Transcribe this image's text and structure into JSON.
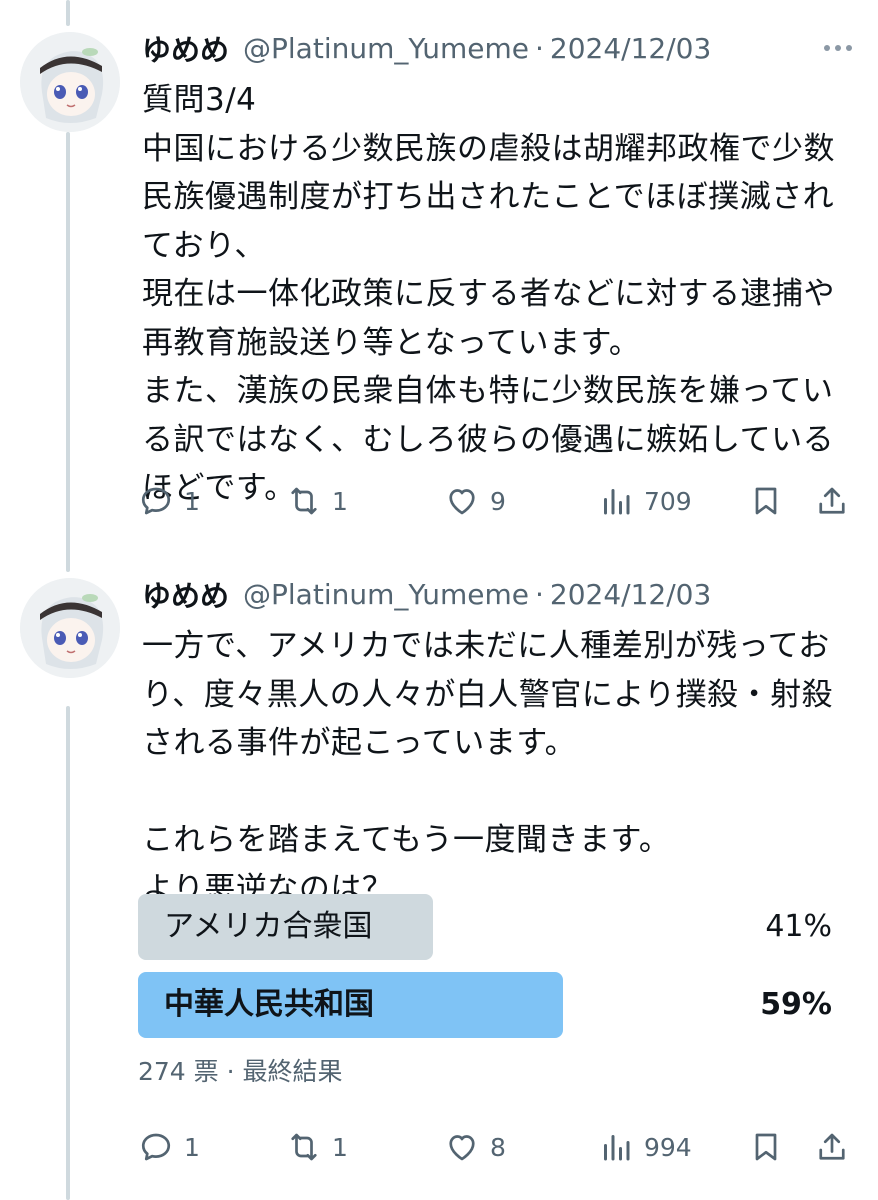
{
  "tweets": [
    {
      "author": {
        "name": "ゆめめ",
        "handle": "@Platinum_Yumeme",
        "separator": "·",
        "date": "2024/12/03"
      },
      "text": "質問3/4\n中国における少数民族の虐殺は胡耀邦政権で少数民族優遇制度が打ち出されたことでほぼ撲滅されており、\n現在は一体化政策に反する者などに対する逮捕や再教育施設送り等となっています。\nまた、漢族の民衆自体も特に少数民族を嫌っている訳ではなく、むしろ彼らの優遇に嫉妬しているほどです。",
      "actions": {
        "replies": "1",
        "reposts": "1",
        "likes": "9",
        "views": "709"
      }
    },
    {
      "author": {
        "name": "ゆめめ",
        "handle": "@Platinum_Yumeme",
        "separator": "·",
        "date": "2024/12/03"
      },
      "text": "一方で、アメリカでは未だに人種差別が残っており、度々黒人の人々が白人警官により撲殺・射殺される事件が起こっています。\n\nこれらを踏まえてもう一度聞きます。\nより悪逆なのは？",
      "poll": {
        "options": [
          {
            "label": "アメリカ合衆国",
            "percent_label": "41%",
            "percent": 41,
            "color": "#cfd9de",
            "winner": false
          },
          {
            "label": "中華人民共和国",
            "percent_label": "59%",
            "percent": 59,
            "color": "#7fc3f5",
            "winner": true
          }
        ],
        "meta": "274 票 · 最終結果"
      },
      "actions": {
        "replies": "1",
        "reposts": "1",
        "likes": "8",
        "views": "994"
      }
    }
  ],
  "icons": {
    "reply": "speech-bubble-icon",
    "repost": "repost-arrows-icon",
    "like": "heart-icon",
    "views": "bar-chart-icon",
    "bookmark": "bookmark-icon",
    "share": "share-upload-icon",
    "more": "more-dots-icon"
  },
  "colors": {
    "text": "#0f1419",
    "secondary": "#536471",
    "thread_line": "#cfd9de"
  }
}
